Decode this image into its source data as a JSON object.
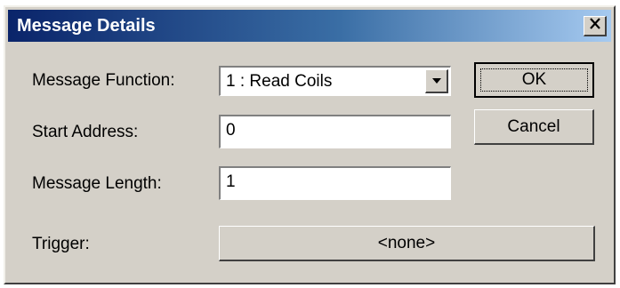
{
  "window": {
    "title": "Message Details",
    "close_icon": "close-icon"
  },
  "form": {
    "message_function_label": "Message Function:",
    "message_function_value": "1 : Read Coils",
    "start_address_label": "Start Address:",
    "start_address_value": "0",
    "message_length_label": "Message Length:",
    "message_length_value": "1",
    "trigger_label": "Trigger:",
    "trigger_value": "<none>"
  },
  "buttons": {
    "ok": "OK",
    "cancel": "Cancel"
  },
  "colors": {
    "dialog_bg": "#d4d0c8",
    "title_start": "#0a246a",
    "title_end": "#a6caf0"
  }
}
